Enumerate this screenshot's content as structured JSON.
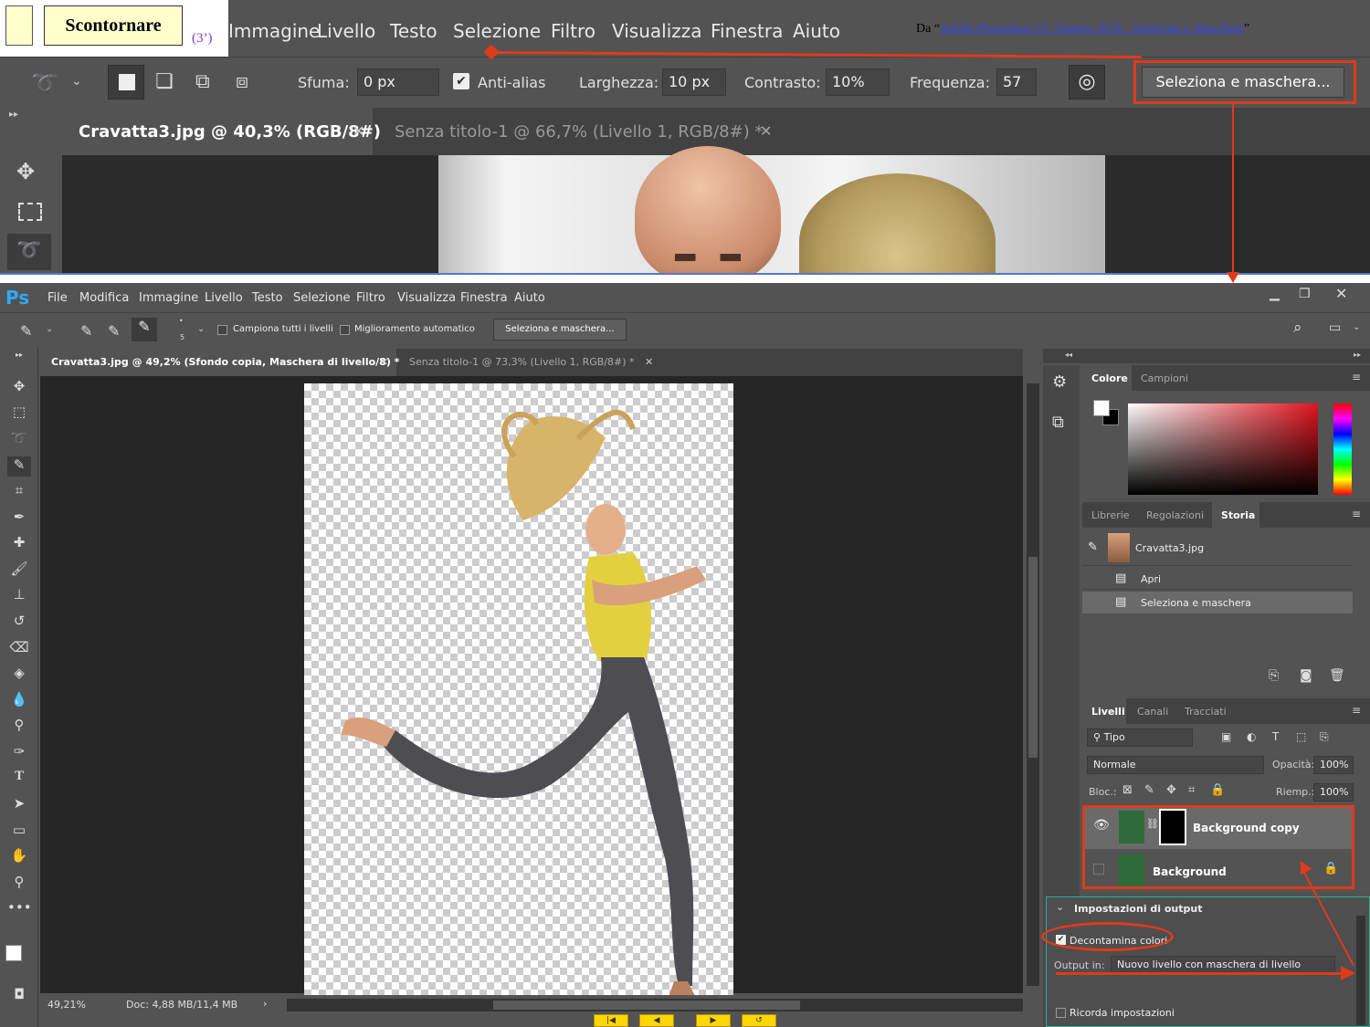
{
  "lesson": {
    "title": "Scontornare",
    "duration": "(3’)",
    "source_prefix": "Da “",
    "source_link": "Adobe Photoshop CC Giugno 2016 - Selezione e Maschere",
    "source_suffix": "”"
  },
  "top": {
    "menu": [
      "Immagine",
      "Livello",
      "Testo",
      "Selezione",
      "Filtro",
      "Visualizza",
      "Finestra",
      "Aiuto"
    ],
    "options": {
      "sfuma_label": "Sfuma:",
      "sfuma_value": "0 px",
      "antialias_label": "Anti-alias",
      "larghezza_label": "Larghezza:",
      "larghezza_value": "10 px",
      "contrasto_label": "Contrasto:",
      "contrasto_value": "10%",
      "frequenza_label": "Frequenza:",
      "frequenza_value": "57",
      "select_mask_button": "Seleziona e maschera..."
    },
    "tabs": [
      "Cravatta3.jpg @ 40,3% (RGB/8#)",
      "Senza titolo-1 @ 66,7% (Livello 1, RGB/8#) *"
    ]
  },
  "app": {
    "logo": "Ps",
    "menu": [
      "File",
      "Modifica",
      "Immagine",
      "Livello",
      "Testo",
      "Selezione",
      "Filtro",
      "Visualizza",
      "Finestra",
      "Aiuto"
    ],
    "options": {
      "brush_size": "5",
      "sample_all": "Campiona tutti i livelli",
      "auto_enhance": "Miglioramento automatico",
      "select_mask_button": "Seleziona e maschera..."
    },
    "tabs": [
      "Cravatta3.jpg @ 49,2% (Sfondo copia, Maschera di livello/8) *",
      "Senza titolo-1 @ 73,3% (Livello 1, RGB/8#) *"
    ],
    "status": {
      "zoom": "49,21%",
      "doc": "Doc: 4,88 MB/11,4 MB"
    },
    "color_panel": {
      "tabs": [
        "Colore",
        "Campioni"
      ]
    },
    "history_panel": {
      "tabs": [
        "Librerie",
        "Regolazioni",
        "Storia"
      ],
      "snapshot": "Cravatta3.jpg",
      "items": [
        "Apri",
        "Seleziona e maschera"
      ]
    },
    "layers_panel": {
      "tabs": [
        "Livelli",
        "Canali",
        "Tracciati"
      ],
      "filter": "Tipo",
      "blend_mode": "Normale",
      "opacity_label": "Opacità:",
      "opacity_value": "100%",
      "lock_label": "Bloc.:",
      "fill_label": "Riemp.:",
      "fill_value": "100%",
      "layers": [
        "Background copy",
        "Background"
      ]
    },
    "output_settings": {
      "title": "Impostazioni di output",
      "decontaminate": "Decontamina colori",
      "output_label": "Output in:",
      "output_value": "Nuovo livello con maschera di livello",
      "remember": "Ricorda impostazioni"
    }
  }
}
